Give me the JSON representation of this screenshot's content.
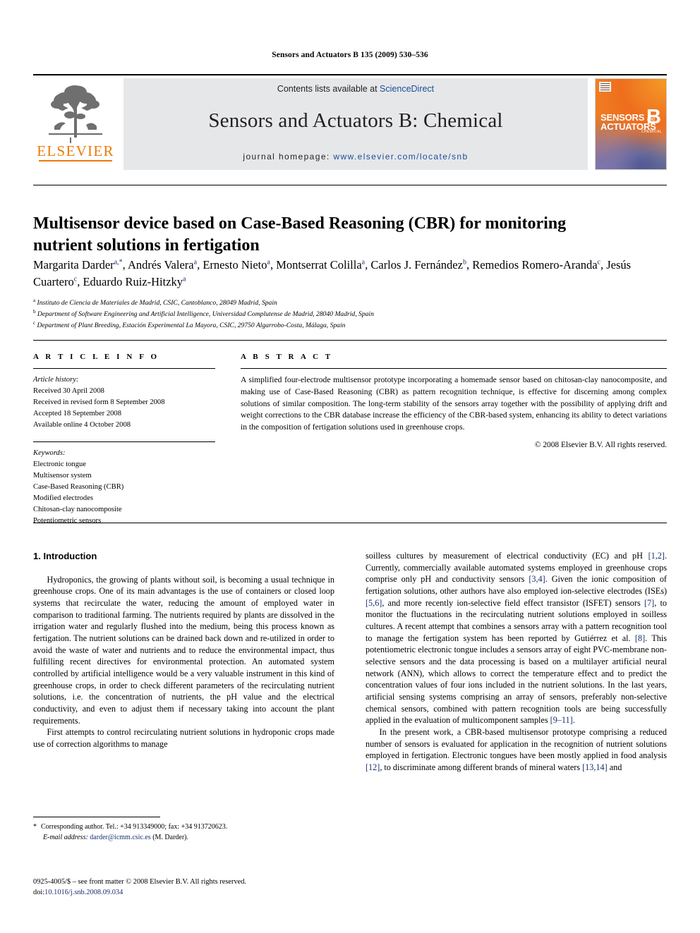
{
  "running_head": "Sensors and Actuators B 135 (2009) 530–536",
  "masthead": {
    "publisher_name": "ELSEVIER",
    "contents_prefix": "Contents lists available at ",
    "contents_link": "ScienceDirect",
    "journal_title": "Sensors and Actuators B: Chemical",
    "homepage_prefix": "journal homepage: ",
    "homepage_url": "www.elsevier.com/locate/snb",
    "cover": {
      "line1": "SENSORS",
      "line1_small": "and",
      "line2": "ACTUATORS",
      "volume_letter": "B",
      "subtitle": "CHEMICAL"
    },
    "accent_orange": "#ec7a08",
    "link_blue": "#1b4d9e",
    "band_gray": "#e6e7e8"
  },
  "article": {
    "title": "Multisensor device based on Case-Based Reasoning (CBR) for monitoring nutrient solutions in fertigation",
    "authors_html": "Margarita Darder<sup>a,*</sup>, Andrés Valera<sup>a</sup>, Ernesto Nieto<sup>a</sup>, Montserrat Colilla<sup>a</sup>, Carlos J. Fernández<sup>b</sup>, Remedios Romero-Aranda<sup>c</sup>, Jesús Cuartero<sup>c</sup>, Eduardo Ruiz-Hitzky<sup>a</sup>",
    "affiliations": [
      {
        "marker": "a",
        "text": "Instituto de Ciencia de Materiales de Madrid, CSIC, Cantoblanco, 28049 Madrid, Spain"
      },
      {
        "marker": "b",
        "text": "Department of Software Engineering and Artificial Intelligence, Universidad Complutense de Madrid, 28040 Madrid, Spain"
      },
      {
        "marker": "c",
        "text": "Department of Plant Breeding, Estación Experimental La Mayora, CSIC, 29750 Algarrobo-Costa, Málaga, Spain"
      }
    ]
  },
  "article_info": {
    "heading": "A R T I C L E   I N F O",
    "history_label": "Article history:",
    "history": [
      "Received 30 April 2008",
      "Received in revised form 8 September 2008",
      "Accepted 18 September 2008",
      "Available online 4 October 2008"
    ],
    "keywords_label": "Keywords:",
    "keywords": [
      "Electronic tongue",
      "Multisensor system",
      "Case-Based Reasoning (CBR)",
      "Modified electrodes",
      "Chitosan-clay nanocomposite",
      "Potentiometric sensors"
    ]
  },
  "abstract": {
    "heading": "A B S T R A C T",
    "text": "A simplified four-electrode multisensor prototype incorporating a homemade sensor based on chitosan-clay nanocomposite, and making use of Case-Based Reasoning (CBR) as pattern recognition technique, is effective for discerning among complex solutions of similar composition. The long-term stability of the sensors array together with the possibility of applying drift and weight corrections to the CBR database increase the efficiency of the CBR-based system, enhancing its ability to detect variations in the composition of fertigation solutions used in greenhouse crops.",
    "copyright": "© 2008 Elsevier B.V. All rights reserved."
  },
  "body": {
    "section_heading": "1. Introduction",
    "left_paragraphs": [
      "Hydroponics, the growing of plants without soil, is becoming a usual technique in greenhouse crops. One of its main advantages is the use of containers or closed loop systems that recirculate the water, reducing the amount of employed water in comparison to traditional farming. The nutrients required by plants are dissolved in the irrigation water and regularly flushed into the medium, being this process known as fertigation. The nutrient solutions can be drained back down and re-utilized in order to avoid the waste of water and nutrients and to reduce the environmental impact, thus fulfilling recent directives for environmental protection. An automated system controlled by artificial intelligence would be a very valuable instrument in this kind of greenhouse crops, in order to check different parameters of the recirculating nutrient solutions, i.e. the concentration of nutrients, the pH value and the electrical conductivity, and even to adjust them if necessary taking into account the plant requirements.",
      "First attempts to control recirculating nutrient solutions in hydroponic crops made use of correction algorithms to manage"
    ],
    "right_paragraph_1_html": "soilless cultures by measurement of electrical conductivity (EC) and pH <span class=\"ref\">[1,2]</span>. Currently, commercially available automated systems employed in greenhouse crops comprise only pH and conductivity sensors <span class=\"ref\">[3,4]</span>. Given the ionic composition of fertigation solutions, other authors have also employed ion-selective electrodes (ISEs) <span class=\"ref\">[5,6]</span>, and more recently ion-selective field effect transistor (ISFET) sensors <span class=\"ref\">[7]</span>, to monitor the fluctuations in the recirculating nutrient solutions employed in soilless cultures. A recent attempt that combines a sensors array with a pattern recognition tool to manage the fertigation system has been reported by Gutiérrez et al. <span class=\"ref\">[8]</span>. This potentiometric electronic tongue includes a sensors array of eight PVC-membrane non-selective sensors and the data processing is based on a multilayer artificial neural network (ANN), which allows to correct the temperature effect and to predict the concentration values of four ions included in the nutrient solutions. In the last years, artificial sensing systems comprising an array of sensors, preferably non-selective chemical sensors, combined with pattern recognition tools are being successfully applied in the evaluation of multicomponent samples <span class=\"ref\">[9–11]</span>.",
    "right_paragraph_2_html": "In the present work, a CBR-based multisensor prototype comprising a reduced number of sensors is evaluated for application in the recognition of nutrient solutions employed in fertigation. Electronic tongues have been mostly applied in food analysis <span class=\"ref\">[12]</span>, to discriminate among different brands of mineral waters <span class=\"ref\">[13,14]</span> and"
  },
  "footnote": {
    "star": "*",
    "corresponding": "Corresponding author. Tel.: +34 913349000; fax: +34 913720623.",
    "email_label": "E-mail address:",
    "email": "darder@icmm.csic.es",
    "email_suffix": "(M. Darder)."
  },
  "issn_line": {
    "text": "0925-4005/$ – see front matter © 2008 Elsevier B.V. All rights reserved.",
    "doi_prefix": "doi:",
    "doi": "10.1016/j.snb.2008.09.034"
  }
}
